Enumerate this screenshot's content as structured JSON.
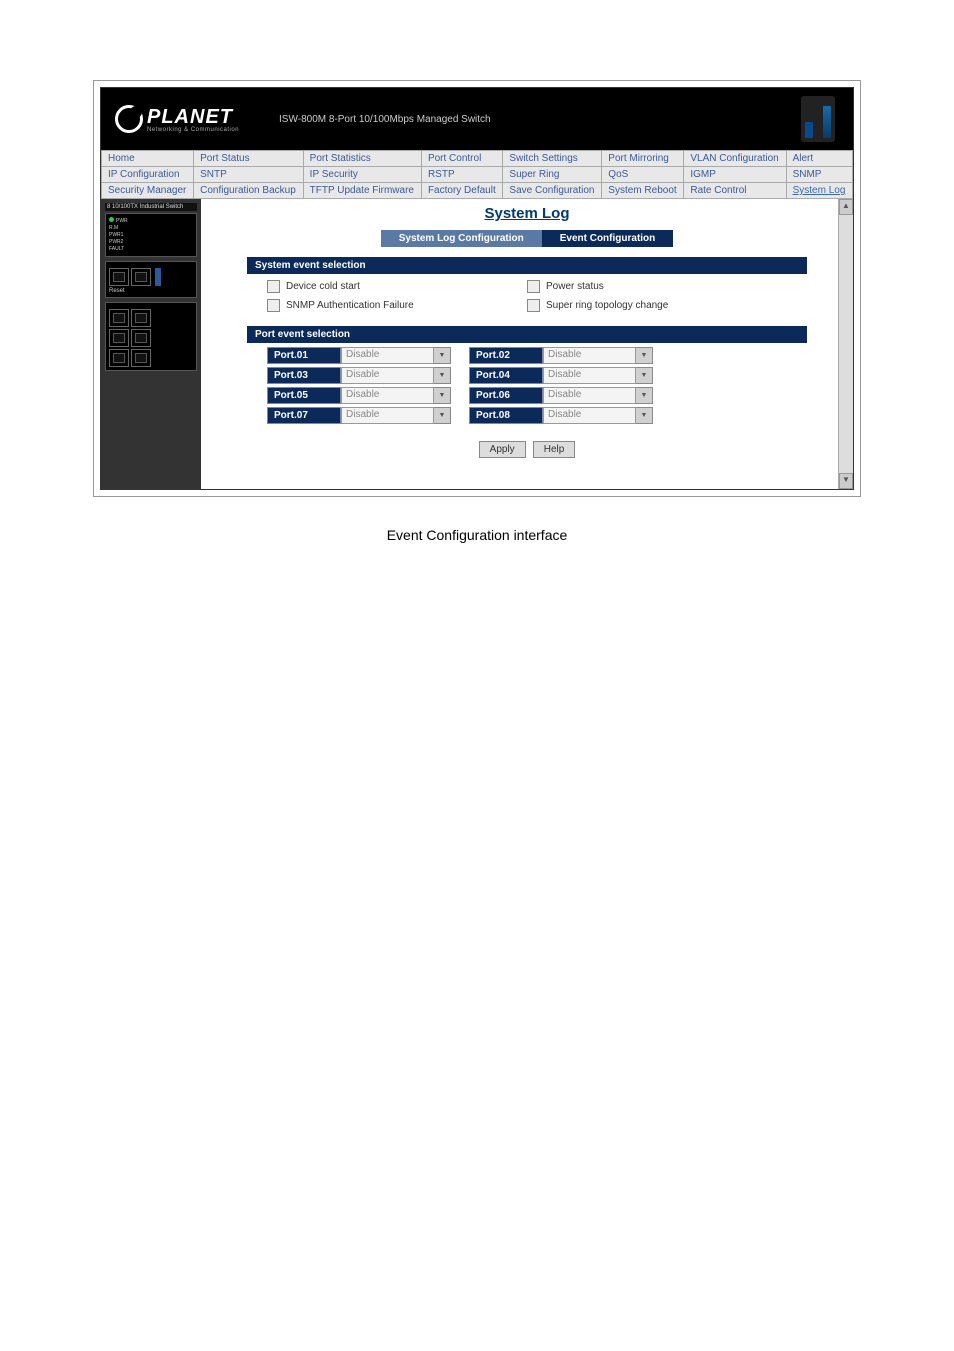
{
  "banner": {
    "brand": "PLANET",
    "tagline": "Networking & Communication",
    "product": "ISW-800M 8-Port 10/100Mbps Managed Switch"
  },
  "nav": {
    "rows": [
      [
        "Home",
        "Port Status",
        "Port Statistics",
        "Port Control",
        "Switch Settings",
        "Port Mirroring",
        "VLAN Configuration",
        "Alert"
      ],
      [
        "IP Configuration",
        "SNTP",
        "IP Security",
        "RSTP",
        "Super Ring",
        "QoS",
        "IGMP",
        "SNMP"
      ],
      [
        "Security Manager",
        "Configuration Backup",
        "TFTP Update Firmware",
        "Factory Default",
        "Save Configuration",
        "System Reboot",
        "Rate Control",
        "System Log"
      ]
    ],
    "active": "System Log"
  },
  "side": {
    "model_label": "8 10/100TX Industrial Switch"
  },
  "main": {
    "title": "System Log",
    "tabs": {
      "inactive": "System Log Configuration",
      "active": "Event Configuration"
    },
    "sys_event": {
      "heading": "System event selection",
      "items": [
        "Device cold start",
        "Power status",
        "SNMP Authentication Failure",
        "Super ring topology change"
      ]
    },
    "port_event": {
      "heading": "Port event selection",
      "ports": [
        {
          "l": "Port.01",
          "lv": "Disable",
          "r": "Port.02",
          "rv": "Disable"
        },
        {
          "l": "Port.03",
          "lv": "Disable",
          "r": "Port.04",
          "rv": "Disable"
        },
        {
          "l": "Port.05",
          "lv": "Disable",
          "r": "Port.06",
          "rv": "Disable"
        },
        {
          "l": "Port.07",
          "lv": "Disable",
          "r": "Port.08",
          "rv": "Disable"
        }
      ]
    },
    "buttons": {
      "apply": "Apply",
      "help": "Help"
    }
  },
  "caption": "Event Configuration interface"
}
